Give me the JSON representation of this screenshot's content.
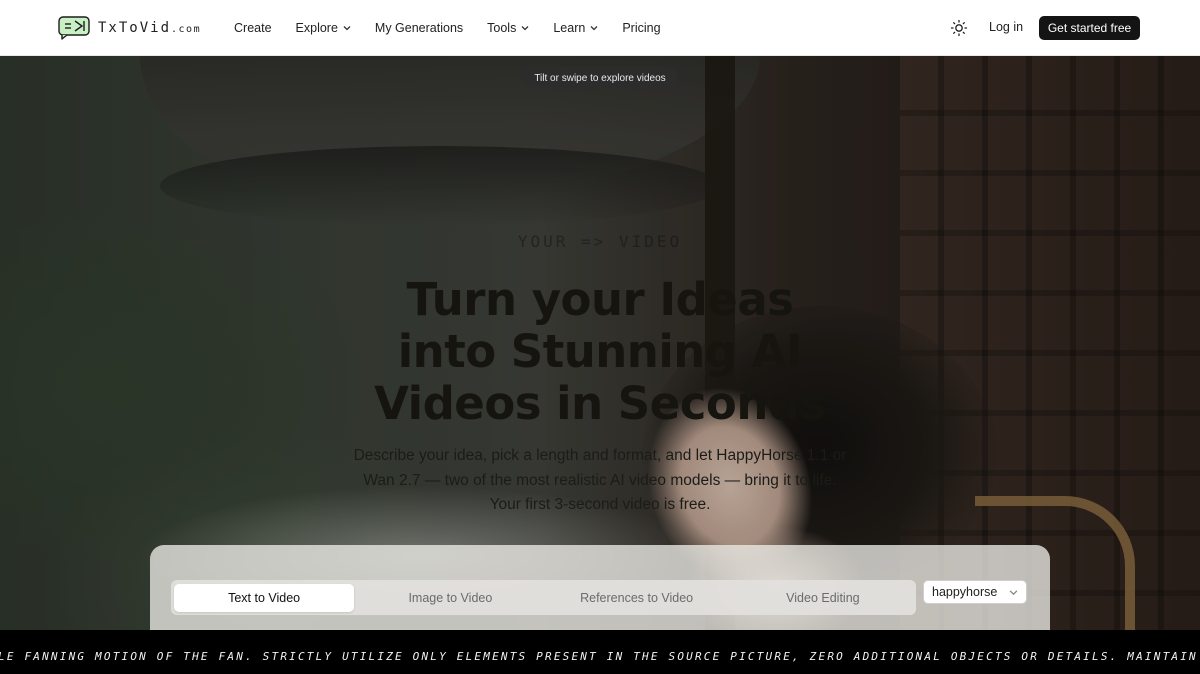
{
  "header": {
    "logo_main": "TxToVid",
    "logo_suffix": ".com",
    "nav": [
      {
        "label": "Create"
      },
      {
        "label": "Explore"
      },
      {
        "label": "My Generations"
      },
      {
        "label": "Tools"
      },
      {
        "label": "Learn"
      },
      {
        "label": "Pricing"
      }
    ],
    "login_label": "Log in",
    "cta_label": "Get started free"
  },
  "hero": {
    "hint": "Tilt or swipe to explore videos",
    "tagline": "YOUR  =>  VIDEO",
    "headline_line1": "Turn your Ideas",
    "headline_line2": "into Stunning AI",
    "headline_line3": "Videos in Seconds",
    "subtext": "Describe your idea, pick a length and format, and let HappyHorse 1.1 or Wan 2.7 — two of the most realistic AI video models — bring it to life. Your first 3-second video is free."
  },
  "panel": {
    "tabs": [
      {
        "label": "Text to Video",
        "active": true
      },
      {
        "label": "Image to Video",
        "active": false
      },
      {
        "label": "References to Video",
        "active": false
      },
      {
        "label": "Video Editing",
        "active": false
      }
    ],
    "model_value": "happyhorse"
  },
  "ticker": {
    "text": "LE FANNING MOTION OF THE FAN. STRICTLY UTILIZE ONLY ELEMENTS PRESENT IN THE SOURCE PICTURE, ZERO ADDITIONAL OBJECTS OR DETAILS. MAINTAIN THE FAN'S OR"
  },
  "colors": {
    "header_bg": "#ffffff",
    "cta_bg": "#141414",
    "ticker_bg": "#000000"
  }
}
